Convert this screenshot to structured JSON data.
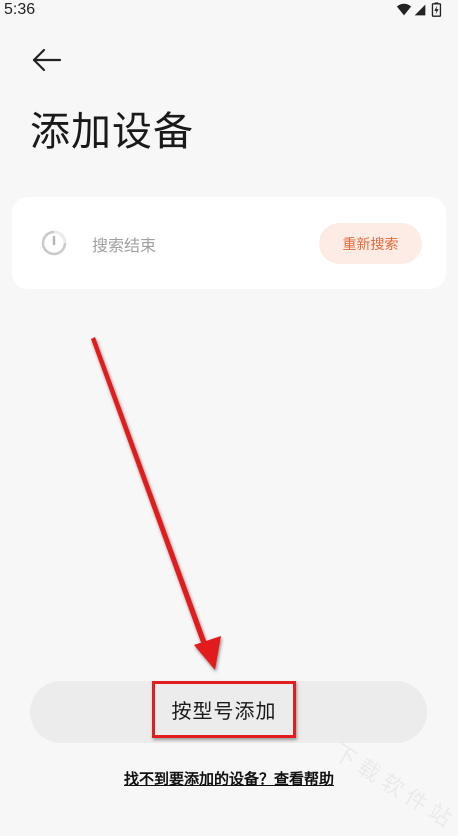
{
  "status_bar": {
    "time": "5:36",
    "icons": [
      "wifi-icon",
      "signal-icon",
      "battery-charging-icon"
    ]
  },
  "header": {
    "back_icon": "arrow-left-icon",
    "title": "添加设备"
  },
  "search_card": {
    "spinner_icon": "loading-spinner-icon",
    "status_text": "搜索结束",
    "research_label": "重新搜索",
    "accent_color": "#e26a3a",
    "button_bg": "#fdece5"
  },
  "annotation": {
    "arrow_color": "#e21d1d",
    "highlight_color": "#e21d1d"
  },
  "actions": {
    "add_by_model_label": "按型号添加",
    "help_link": "找不到要添加的设备？查看帮助"
  },
  "watermark": {
    "text": "下载软件站"
  }
}
